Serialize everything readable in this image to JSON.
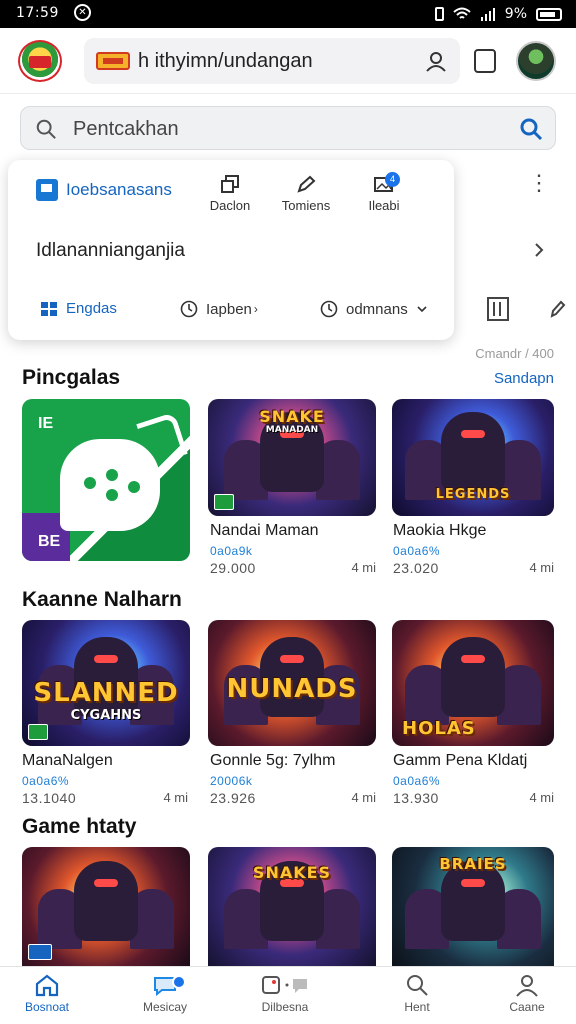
{
  "status": {
    "time": "17:59",
    "battery": "9%"
  },
  "browser": {
    "address": "h ithyimn/undangan",
    "tabs_count": ""
  },
  "search": {
    "placeholder": "Pentcakhan"
  },
  "popup": {
    "brand": "Ioebsanasans",
    "actions": [
      {
        "label": "Daclon",
        "icon": "copy-icon"
      },
      {
        "label": "Tomiens",
        "icon": "pencil-icon"
      },
      {
        "label": "Ileabi",
        "icon": "image-icon",
        "badge": "4"
      }
    ],
    "row_text": "Idlanannianganjia",
    "footer": [
      {
        "label": "Engdas",
        "icon": "grid-icon"
      },
      {
        "label": "Iapben",
        "icon": "clock-icon"
      },
      {
        "label": "odmnans",
        "icon": "clock-icon"
      }
    ]
  },
  "count_label": "Cmandr / 400",
  "sections": [
    {
      "title": "Pincgalas",
      "see_all": "Sandapn",
      "items": [
        {
          "name": "",
          "sub": "",
          "meta": "",
          "size": "",
          "art": "green-app",
          "badge_tl": "IE",
          "badge_bl": "BE"
        },
        {
          "name": "Nandai Maman",
          "sub": "0a0a9k",
          "meta": "29.000",
          "size": "4 mi",
          "art": "art",
          "title": "SNAKE",
          "sub_title": "MANADAN"
        },
        {
          "name": "Maokia Hkge",
          "sub": "0a0a6%",
          "meta": "23.020",
          "size": "4 mi",
          "art": "art blue",
          "title": "LEGENDS",
          "sub_title": ""
        }
      ]
    },
    {
      "title": "Kaanne Nalharn",
      "items": [
        {
          "name": "ManaNalgen",
          "sub": "0a0a6%",
          "meta": "13.1040",
          "size": "4 mi",
          "art": "art blue",
          "title": "SLANNED",
          "sub_title": "CYGAHNS"
        },
        {
          "name": "Gonnle 5g: 7ylhm",
          "sub": "20006k",
          "meta": "23.926",
          "size": "4 mi",
          "art": "art fire",
          "title": "NUNADS",
          "sub_title": ""
        },
        {
          "name": "Gamm Pena Kldatj",
          "sub": "0a0a6%",
          "meta": "13.930",
          "size": "4 mi",
          "art": "art fire",
          "title": "HOLAS",
          "sub_title": ""
        }
      ]
    },
    {
      "title": "Game htaty",
      "items": [
        {
          "name": "",
          "sub": "",
          "meta": "",
          "size": "",
          "art": "art fire",
          "title": "",
          "sub_title": ""
        },
        {
          "name": "",
          "sub": "",
          "meta": "",
          "size": "",
          "art": "art",
          "title": "SNAKES",
          "sub_title": ""
        },
        {
          "name": "",
          "sub": "",
          "meta": "",
          "size": "",
          "art": "art teal",
          "title": "BRAIES",
          "sub_title": ""
        }
      ]
    }
  ],
  "bottom_nav": [
    {
      "label": "Bosnoat",
      "icon": "home-icon"
    },
    {
      "label": "Mesicay",
      "icon": "chat-icon"
    },
    {
      "label": "Dilbesna",
      "icon": "game-icon"
    },
    {
      "label": "Hent",
      "icon": "search-icon"
    },
    {
      "label": "Caane",
      "icon": "person-icon"
    }
  ],
  "colors": {
    "accent": "#1565c0",
    "bar": "#000000"
  }
}
